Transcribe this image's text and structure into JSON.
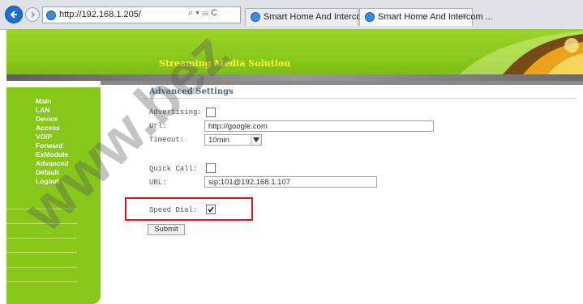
{
  "browser": {
    "address": "http://192.168.1.205/",
    "address_tools": "⌕ ▾ ☰ C",
    "tabs": [
      {
        "label": "Smart Home And Intercom Sys..."
      },
      {
        "label": "Smart Home And Intercom ...",
        "close": "×"
      }
    ]
  },
  "banner": {
    "title": "Streaming Media Solution"
  },
  "sidebar": {
    "items": [
      {
        "label": "Main"
      },
      {
        "label": "LAN"
      },
      {
        "label": "Device"
      },
      {
        "label": "Access"
      },
      {
        "label": "VOIP"
      },
      {
        "label": "Forward"
      },
      {
        "label": "ExModule"
      },
      {
        "label": "Advanced"
      },
      {
        "label": "Default"
      },
      {
        "label": "Logout"
      }
    ]
  },
  "main": {
    "title": "Advanced Settings",
    "advertising": {
      "label": "Advertising:",
      "checked": false
    },
    "url": {
      "label": "Url:",
      "value": "http://google.com"
    },
    "timeout": {
      "label": "Timeout:",
      "value": "10min"
    },
    "quick_call": {
      "label": "Quick Call:",
      "checked": false
    },
    "quick_url": {
      "label": "URL:",
      "value": "sip:101@192.168.1.107"
    },
    "speed_dial": {
      "label": "Speed Dial:",
      "checked": true
    },
    "submit": "Submit"
  },
  "watermark": {
    "text": "www.bez"
  },
  "colors": {
    "sidebar_green": "#86c71a",
    "banner_green": "#8ac81b",
    "highlight_red": "#e0161b",
    "title_blue": "#4a6b88"
  }
}
